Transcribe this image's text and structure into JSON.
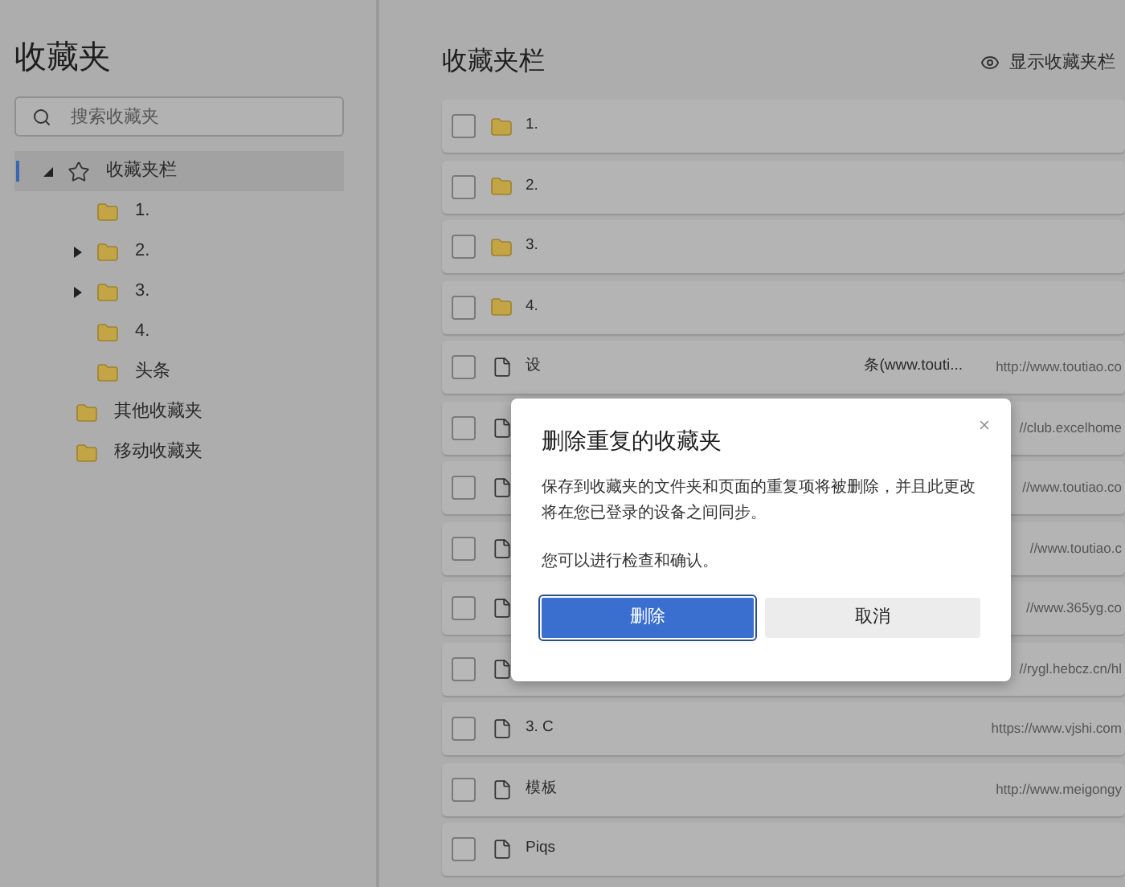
{
  "sidebar": {
    "title": "收藏夹",
    "search": {
      "placeholder": "搜索收藏夹"
    },
    "tree": [
      {
        "label": "收藏夹栏",
        "kind": "root",
        "expandable": true,
        "expanded": true,
        "selected": true,
        "children": [
          {
            "label": "1.",
            "expandable": false,
            "selected": false
          },
          {
            "label": "2.",
            "expandable": true,
            "expanded": false,
            "selected": false
          },
          {
            "label": "3.",
            "expandable": true,
            "expanded": false,
            "selected": false
          },
          {
            "label": "4.",
            "expandable": false,
            "selected": false
          },
          {
            "label": "头条",
            "expandable": false,
            "selected": false
          }
        ]
      },
      {
        "label": "其他收藏夹",
        "kind": "folder",
        "expandable": false,
        "selected": false
      },
      {
        "label": "移动收藏夹",
        "kind": "folder",
        "expandable": false,
        "selected": false
      }
    ]
  },
  "main": {
    "title": "收藏夹栏",
    "show_bar_button": "显示收藏夹栏",
    "rows": [
      {
        "kind": "folder",
        "title": "1.",
        "checked": false
      },
      {
        "kind": "folder",
        "title": "2.",
        "checked": false
      },
      {
        "kind": "folder",
        "title": "3.",
        "checked": false
      },
      {
        "kind": "folder",
        "title": "4.",
        "checked": false
      },
      {
        "kind": "page",
        "title": "设",
        "title_tail": "条(www.touti...",
        "url": "http://www.toutiao.co",
        "checked": false
      },
      {
        "kind": "page",
        "url": "//club.excelhome",
        "checked": false
      },
      {
        "kind": "page",
        "url": "//www.toutiao.co",
        "checked": false
      },
      {
        "kind": "page",
        "url": "//www.toutiao.c",
        "checked": false
      },
      {
        "kind": "page",
        "url": "//www.365yg.co",
        "checked": false
      },
      {
        "kind": "page",
        "url": "//rygl.hebcz.cn/hl",
        "checked": false
      },
      {
        "kind": "page",
        "title": "3. C",
        "url": "https://www.vjshi.com",
        "checked": false
      },
      {
        "kind": "page",
        "title": "模板",
        "url": "http://www.meigongy",
        "checked": false
      },
      {
        "kind": "page",
        "title": "Piqs",
        "checked": false
      }
    ]
  },
  "dialog": {
    "title": "删除重复的收藏夹",
    "message": "保存到收藏夹的文件夹和页面的重复项将被删除，并且此更改将在您已登录的设备之间同步。",
    "note": "您可以进行检查和确认。",
    "primary_button": "删除",
    "secondary_button": "取消"
  }
}
